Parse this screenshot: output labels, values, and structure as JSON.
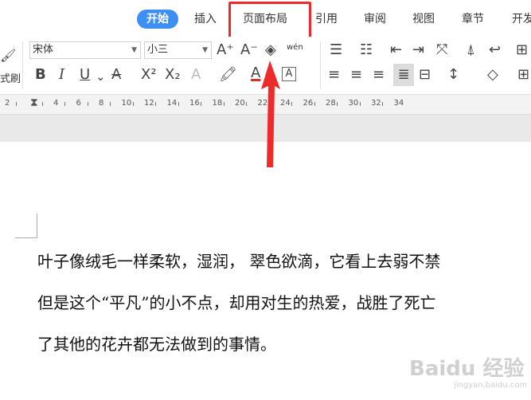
{
  "tabs": [
    {
      "label": "开始",
      "active": true
    },
    {
      "label": "插入"
    },
    {
      "label": "页面布局",
      "highlighted": true
    },
    {
      "label": "引用"
    },
    {
      "label": "审阅"
    },
    {
      "label": "视图"
    },
    {
      "label": "章节"
    },
    {
      "label": "开发"
    }
  ],
  "toolbar": {
    "format_painter_label": "式刷",
    "font_name": "宋体",
    "font_size": "小三",
    "grow_font": "A⁺",
    "shrink_font": "A⁻",
    "pinyin_label": "wén",
    "bold": "B",
    "italic": "I",
    "underline": "U",
    "strike": "A",
    "superscript": "X²",
    "subscript": "X₂",
    "font_color": "A",
    "char_border": "A"
  },
  "ruler": {
    "marks": [
      "2",
      "2",
      "4",
      "6",
      "8",
      "10",
      "12",
      "14",
      "16",
      "18",
      "20",
      "22",
      "24",
      "26",
      "28",
      "30",
      "32",
      "34"
    ]
  },
  "document": {
    "lines": [
      "叶子像绒毛一样柔软，湿润，  翠色欲滴，它看上去弱不禁",
      "但是这个“平凡”的小不点，却用对生的热爱，战胜了死亡",
      "了其他的花卉都无法做到的事情。"
    ]
  },
  "watermark": {
    "text": "Baidu 经验",
    "url": "jingyan.baidu.com"
  },
  "colors": {
    "accent": "#3d8ff4",
    "highlight": "#ee2b2b"
  }
}
